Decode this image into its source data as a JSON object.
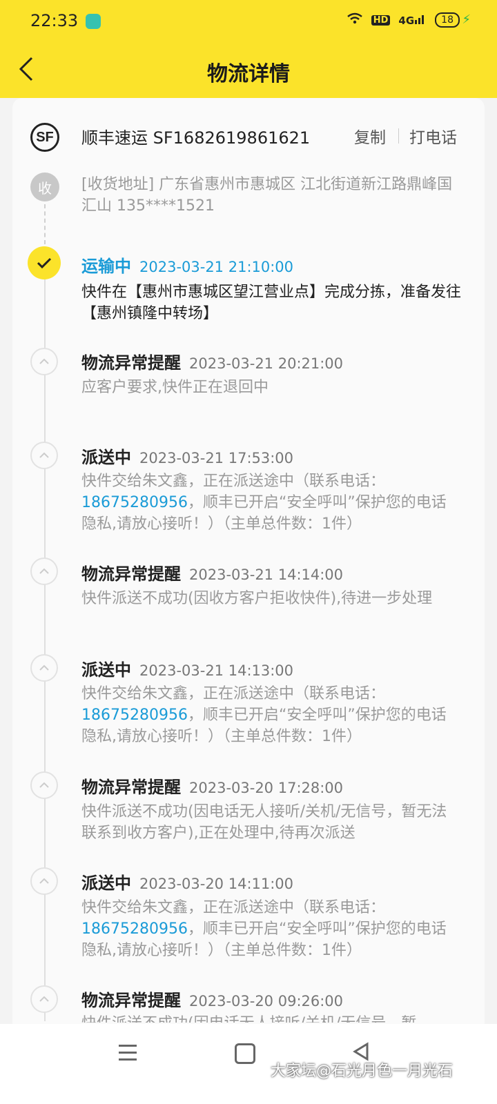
{
  "status_bar": {
    "time": "22:33",
    "network": "4G",
    "hd": "HD",
    "battery": "18"
  },
  "header": {
    "title": "物流详情"
  },
  "shipment": {
    "carrier_logo": "SF",
    "carrier_tracking": "顺丰速运 SF1682619861621",
    "copy_label": "复制",
    "call_label": "打电话"
  },
  "receiver": {
    "badge": "收",
    "address": "[收货地址] 广东省惠州市惠城区 江北街道新江路鼎峰国汇山 135****1521"
  },
  "events": [
    {
      "status": "运输中",
      "time": "2023-03-21 21:10:00",
      "desc": "快件在【惠州市惠城区望江营业点】完成分拣，准备发往 【惠州镇隆中转场】"
    },
    {
      "status": "物流异常提醒",
      "time": "2023-03-21 20:21:00",
      "desc": "应客户要求,快件正在退回中"
    },
    {
      "status": "派送中",
      "time": "2023-03-21 17:53:00",
      "desc_pre": "快件交给朱文鑫，正在派送途中（联系电话：",
      "phone": "18675280956",
      "desc_post": "，顺丰已开启“安全呼叫”保护您的电话隐私,请放心接听！）（主单总件数：1件）"
    },
    {
      "status": "物流异常提醒",
      "time": "2023-03-21 14:14:00",
      "desc": "快件派送不成功(因收方客户拒收快件),待进一步处理"
    },
    {
      "status": "派送中",
      "time": "2023-03-21 14:13:00",
      "desc_pre": "快件交给朱文鑫，正在派送途中（联系电话：",
      "phone": "18675280956",
      "desc_post": "，顺丰已开启“安全呼叫”保护您的电话隐私,请放心接听！）（主单总件数：1件）"
    },
    {
      "status": "物流异常提醒",
      "time": "2023-03-20 17:28:00",
      "desc": "快件派送不成功(因电话无人接听/关机/无信号，暂无法联系到收方客户),正在处理中,待再次派送"
    },
    {
      "status": "派送中",
      "time": "2023-03-20 14:11:00",
      "desc_pre": "快件交给朱文鑫，正在派送途中（联系电话：",
      "phone": "18675280956",
      "desc_post": "，顺丰已开启“安全呼叫”保护您的电话隐私,请放心接听！）（主单总件数：1件）"
    },
    {
      "status": "物流异常提醒",
      "time": "2023-03-20 09:26:00",
      "desc": "快件派送不成功(因电话无人接听/关机/无信号，暂"
    }
  ],
  "watermark": "大家坛@石光月色一月光石",
  "colors": {
    "brand_yellow": "#fbe32a",
    "link_blue": "#1a9bd7"
  }
}
